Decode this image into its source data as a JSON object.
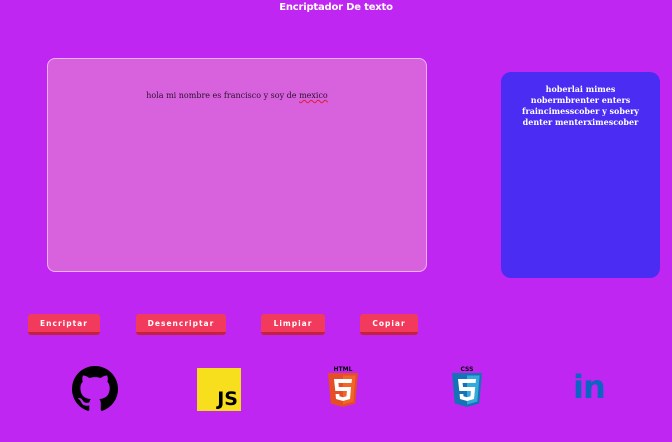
{
  "header": {
    "title": "Encriptador De texto"
  },
  "input": {
    "text_before": "hola mi nombre es francisco y soy de ",
    "text_misspelled": "mexico"
  },
  "output": {
    "text": "hoberlai mimes nobermbrenter enters fraincimesscober y sobery denter menterximescober"
  },
  "buttons": {
    "encrypt": "Encriptar",
    "decrypt": "Desencriptar",
    "clear": "Limpiar",
    "copy": "Copiar"
  },
  "footer": {
    "icons": [
      "github-icon",
      "javascript-icon",
      "html5-icon",
      "css3-icon",
      "linkedin-icon"
    ],
    "html_badge": "HTML",
    "css_badge": "CSS",
    "js_badge": "JS",
    "linkedin_badge": "in"
  },
  "colors": {
    "background": "#c026f2",
    "input_bg": "#d862de",
    "output_bg": "#4a2cf2",
    "button": "#f23a5c",
    "html": "#e44d26",
    "css": "#2965f1",
    "js": "#f7df1e",
    "linkedin": "#0a66c2"
  }
}
